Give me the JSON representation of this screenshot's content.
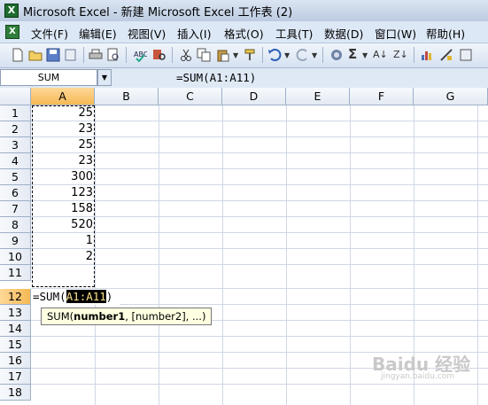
{
  "window": {
    "title": "Microsoft Excel - 新建 Microsoft Excel 工作表 (2)"
  },
  "menu": [
    {
      "label": "文件(F)"
    },
    {
      "label": "编辑(E)"
    },
    {
      "label": "视图(V)"
    },
    {
      "label": "插入(I)"
    },
    {
      "label": "格式(O)"
    },
    {
      "label": "工具(T)"
    },
    {
      "label": "数据(D)"
    },
    {
      "label": "窗口(W)"
    },
    {
      "label": "帮助(H)"
    }
  ],
  "namebox": {
    "value": "SUM"
  },
  "formula": {
    "text": "=SUM(A1:A11)"
  },
  "columns": [
    "A",
    "B",
    "C",
    "D",
    "E",
    "F",
    "G"
  ],
  "rows": [
    "1",
    "2",
    "3",
    "4",
    "5",
    "6",
    "7",
    "8",
    "9",
    "10",
    "11",
    "12",
    "13",
    "14",
    "15",
    "16",
    "17",
    "18"
  ],
  "cells_A": [
    "25",
    "23",
    "25",
    "23",
    "300",
    "123",
    "158",
    "520",
    "1",
    "2"
  ],
  "edit": {
    "prefix": "=SUM(",
    "range": "A1:A11",
    "suffix": ")"
  },
  "tooltip": {
    "prefix": "SUM(",
    "bold": "number1",
    "rest": ", [number2], ...)"
  },
  "toolbar": {
    "sigma": "Σ",
    "sort_asc": "A↓",
    "sort_desc": "Z↓"
  },
  "watermark": {
    "text": "Baidu 经验",
    "sub": "jingyan.baidu.com"
  },
  "icons": {
    "app": "excel-app-icon",
    "new": "new-file-icon",
    "open": "open-folder-icon",
    "save": "save-icon",
    "print": "print-icon",
    "undo": "undo-icon",
    "redo": "redo-icon",
    "autosum": "autosum-icon"
  },
  "colors": {
    "selected_header": "#f5b955",
    "menu_bg": "#dde8f6"
  }
}
